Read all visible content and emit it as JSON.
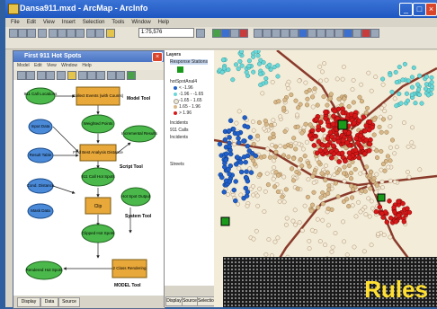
{
  "window": {
    "title": "Dansa911.mxd - ArcMap - ArcInfo",
    "menu": [
      "File",
      "Edit",
      "View",
      "Insert",
      "Selection",
      "Tools",
      "Window",
      "Help"
    ],
    "scale": "1:75,576"
  },
  "model_builder": {
    "title": "First 911 Hot Spots",
    "menu": [
      "Model",
      "Edit",
      "View",
      "Window",
      "Help"
    ],
    "nodes": [
      {
        "label": "911 Call Locations"
      },
      {
        "label": "Collect Events (with Counts)"
      },
      {
        "label": "Weighted Points"
      },
      {
        "label": "Incremental Results"
      },
      {
        "label": "Input Data"
      },
      {
        "label": "Find Best Analysis Distance"
      },
      {
        "label": "Result Table"
      },
      {
        "label": "Cond. Distance"
      },
      {
        "label": "911 Call Hot Spots"
      },
      {
        "label": "Hot Spot Output"
      },
      {
        "label": "Clip"
      },
      {
        "label": "Mask Data"
      },
      {
        "label": "Clipped Hot Spots"
      },
      {
        "label": "Rendered Hot Spots"
      },
      {
        "label": "2 Class Rendering"
      }
    ],
    "side_labels": {
      "model_tool": "Model Tool",
      "script_tool": "Script Tool",
      "system_tool": "System Tool",
      "model_tool2": "MODEL Tool"
    },
    "tabs": [
      "Display",
      "Data",
      "Source"
    ]
  },
  "toc": {
    "header": "Layers",
    "rows": [
      "Response Stations",
      "hotSpotAnal4",
      "< -1.96",
      "-1.96 - -1.65",
      "-1.65 - 1.65",
      "1.65 - 1.96",
      "> 1.96",
      "Incidents",
      "911 Calls",
      "Incidents",
      "Streets"
    ],
    "tabs": [
      "Display",
      "Source",
      "Selection"
    ]
  },
  "overlay": {
    "label": "Rules"
  },
  "colors": {
    "titlebar": "#2a62c8",
    "hot": "#d81818",
    "cold": "#2060c8",
    "neutral": "#d8b888",
    "light_cold": "#6ad8d8",
    "station": "#1a9a1a",
    "road": "#8a3a2a",
    "rules_text": "#ffe030"
  }
}
